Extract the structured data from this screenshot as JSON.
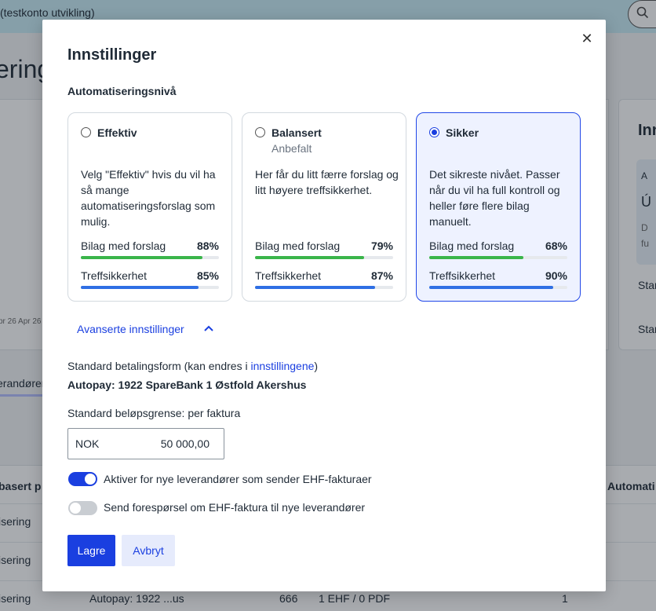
{
  "background": {
    "org_name": "(testkonto utvikling)",
    "heading": "ering",
    "side_card_title": "Inn",
    "side_card_inner_lines": [
      "A",
      "Ú",
      "D",
      "fu"
    ],
    "side_card_row1": "Stand",
    "side_card_row2": "Stand",
    "axis_ticks": "pr 26   Apr 26",
    "tab_label": "erandører",
    "table": {
      "header_left": "basert p",
      "header_right": "Automati",
      "rows": [
        {
          "c1": "isering",
          "c2": "",
          "c3": "",
          "c4": "",
          "c5": ""
        },
        {
          "c1": "isering",
          "c2": "",
          "c3": "",
          "c4": "",
          "c5": ""
        },
        {
          "c1": "isering",
          "c2": "Autopay: 1922 ...us",
          "c3": "666",
          "c4": "1 EHF / 0 PDF",
          "c5": "1"
        }
      ]
    }
  },
  "modal": {
    "title": "Innstillinger",
    "close_glyph": "✕",
    "section_label": "Automatiseringsnivå",
    "options": [
      {
        "name": "Effektiv",
        "subtitle": "",
        "description": "Velg \"Effektiv\" hvis du vil ha så mange automatiseringsforslag som mulig.",
        "metric1_label": "Bilag med forslag",
        "metric1_value": "88%",
        "metric1_fraction": 0.88,
        "metric2_label": "Treffsikkerhet",
        "metric2_value": "85%",
        "metric2_fraction": 0.85,
        "selected": false
      },
      {
        "name": "Balansert",
        "subtitle": "Anbefalt",
        "description": "Her får du litt færre forslag og litt høyere treffsikkerhet.",
        "metric1_label": "Bilag med forslag",
        "metric1_value": "79%",
        "metric1_fraction": 0.79,
        "metric2_label": "Treffsikkerhet",
        "metric2_value": "87%",
        "metric2_fraction": 0.87,
        "selected": false
      },
      {
        "name": "Sikker",
        "subtitle": "",
        "description": "Det sikreste nivået. Passer når du vil ha full kontroll og heller føre flere bilag manuelt.",
        "metric1_label": "Bilag med forslag",
        "metric1_value": "68%",
        "metric1_fraction": 0.68,
        "metric2_label": "Treffsikkerhet",
        "metric2_value": "90%",
        "metric2_fraction": 0.9,
        "selected": true
      }
    ],
    "advanced_label": "Avanserte innstillinger",
    "payment": {
      "label_before": "Standard betalingsform (kan endres i ",
      "label_link": "innstillingene",
      "label_after": ")",
      "value": "Autopay: 1922 SpareBank 1 Østfold Akershus"
    },
    "limit": {
      "label": "Standard beløpsgrense: per faktura",
      "currency": "NOK",
      "value": "50 000,00"
    },
    "toggles": [
      {
        "label": "Aktiver for nye leverandører som sender EHF-fakturaer",
        "on": true
      },
      {
        "label": "Send forespørsel om EHF-faktura til nye leverandører",
        "on": false
      }
    ],
    "save_label": "Lagre",
    "cancel_label": "Avbryt"
  },
  "colors": {
    "primary": "#1a3fe0",
    "metric_green": "#3ab54a",
    "metric_blue": "#2f6fe4",
    "selected_bg": "#eef2ff"
  }
}
